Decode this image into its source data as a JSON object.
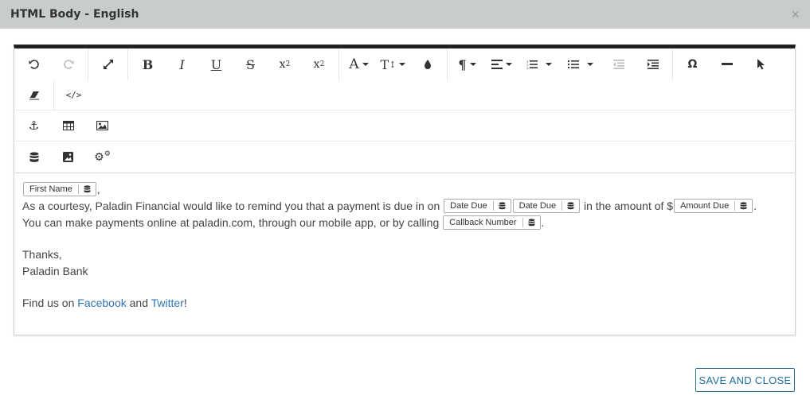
{
  "modal": {
    "title": "HTML Body - English",
    "close_symbol": "×"
  },
  "toolbar": {
    "row1": [
      "undo-icon",
      "redo-icon",
      "fullscreen-icon",
      "bold-icon",
      "italic-icon",
      "underline-icon",
      "strikethrough-icon",
      "subscript-icon",
      "superscript-icon",
      "font-family-icon",
      "font-size-icon",
      "color-icon",
      "paragraph-format-icon",
      "align-icon",
      "ordered-list-icon",
      "unordered-list-icon",
      "outdent-icon",
      "indent-icon",
      "special-chars-icon",
      "horizontal-line-icon",
      "select-all-icon"
    ],
    "row2": [
      "clear-formatting-icon",
      "code-view-icon"
    ],
    "row3": [
      "anchor-icon",
      "table-icon",
      "image-icon"
    ],
    "row4": [
      "database-icon",
      "image-manager-icon",
      "settings-icon"
    ]
  },
  "content": {
    "first_name_tag": "First Name",
    "first_line_suffix": ",",
    "line2_a": "As a courtesy, Paladin Financial would like to remind you that a payment is due in on ",
    "date_due_tag_1": "Date Due",
    "date_due_tag_2": "Date Due",
    "line2_b": " in the amount of $",
    "amount_due_tag": "Amount Due",
    "line2_end": ".",
    "line3_a": "You can make payments online at paladin.com, through our mobile app, or by calling ",
    "callback_tag": "Callback Number",
    "line3_end": ".",
    "thanks": "Thanks,",
    "signature": "Paladin Bank",
    "find_us_prefix": "Find us on ",
    "facebook_link": "Facebook",
    "and_text": " and ",
    "twitter_link": "Twitter",
    "find_us_suffix": "!"
  },
  "footer": {
    "save_label": "SAVE AND CLOSE"
  },
  "colors": {
    "header_bg": "#c8cdcc",
    "link": "#2f74b5",
    "primary_button": "#1f6da1"
  }
}
